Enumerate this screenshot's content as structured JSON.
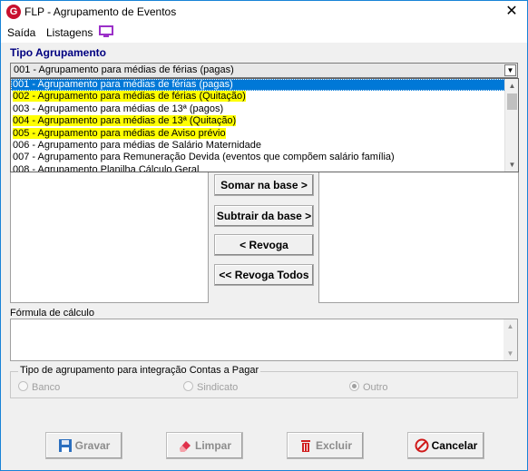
{
  "window": {
    "title": "FLP - Agrupamento de Eventos",
    "app_icon_glyph": "G",
    "close_glyph": "✕"
  },
  "menu": {
    "saida": "Saída",
    "listagens": "Listagens"
  },
  "tipo_agrupamento": {
    "label": "Tipo Agrupamento",
    "selected_value": "001 - Agrupamento para médias de férias (pagas)",
    "options": [
      {
        "label": "001 - Agrupamento para médias de férias (pagas)",
        "state": "selected"
      },
      {
        "label": "002 - Agrupamento para médias de férias (Quitação)",
        "state": "highlighted"
      },
      {
        "label": "003 - Agrupamento para médias de 13ª (pagos)",
        "state": "normal"
      },
      {
        "label": "004 - Agrupamento para médias de 13ª (Quitação)",
        "state": "highlighted"
      },
      {
        "label": "005 - Agrupamento para médias de Aviso prévio",
        "state": "highlighted"
      },
      {
        "label": "006 - Agrupamento para médias de Salário Maternidade",
        "state": "normal"
      },
      {
        "label": "007 - Agrupamento para Remuneração Devida (eventos que compõem salário família)",
        "state": "normal"
      },
      {
        "label": "008 - Agrupamento Planilha Cálculo Geral",
        "state": "normal"
      }
    ]
  },
  "actions": {
    "somar": "Somar  na base >",
    "subtrair": "Subtrair da base >",
    "revoga": "< Revoga",
    "revoga_todos": "<< Revoga Todos"
  },
  "formula": {
    "label": "Fórmula de cálculo",
    "value": ""
  },
  "integracao": {
    "title": "Tipo de agrupamento para integração Contas a Pagar",
    "options": [
      "Banco",
      "Sindicato",
      "Outro"
    ],
    "selected": "Outro"
  },
  "buttons": {
    "gravar": "Gravar",
    "limpar": "Limpar",
    "excluir": "Excluir",
    "cancelar": "Cancelar"
  },
  "colors": {
    "highlight_yellow": "#ffff00",
    "selection_blue": "#0078d7",
    "section_label": "#000080"
  }
}
